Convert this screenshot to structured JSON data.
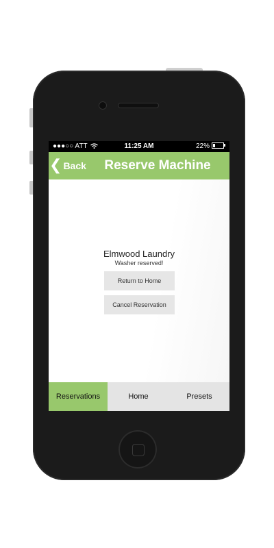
{
  "status_bar": {
    "signal_carrier": "●●●○○ ATT",
    "wifi_icon": "wifi-icon",
    "time": "11:25 AM",
    "battery_percent": "22%",
    "battery_level": 0.22
  },
  "nav": {
    "back_label": "Back",
    "title": "Reserve Machine"
  },
  "main": {
    "laundry_name": "Elmwood Laundry",
    "message": "Washer reserved!",
    "return_button": "Return to Home",
    "cancel_button": "Cancel Reservation"
  },
  "tabs": [
    {
      "label": "Reservations",
      "active": true
    },
    {
      "label": "Home",
      "active": false
    },
    {
      "label": "Presets",
      "active": false
    }
  ],
  "colors": {
    "accent_green": "#98c86c",
    "tab_bar_bg": "#e4e4e4",
    "button_bg": "#e6e6e6",
    "phone_body": "#1b1b1b"
  }
}
